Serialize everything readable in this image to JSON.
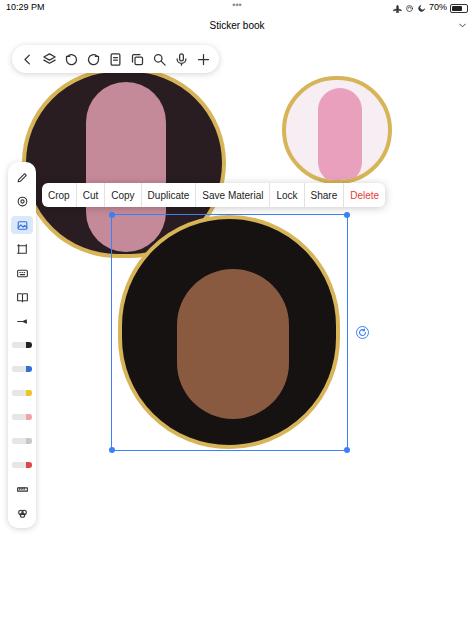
{
  "status_bar": {
    "time": "10:29 PM",
    "dots": "•••",
    "battery": "70%"
  },
  "document": {
    "title": "Sticker book"
  },
  "context_menu": {
    "items": [
      {
        "label": "Crop",
        "kind": "normal"
      },
      {
        "label": "Cut",
        "kind": "normal"
      },
      {
        "label": "Copy",
        "kind": "normal"
      },
      {
        "label": "Duplicate",
        "kind": "normal"
      },
      {
        "label": "Save Material",
        "kind": "normal"
      },
      {
        "label": "Lock",
        "kind": "normal"
      },
      {
        "label": "Share",
        "kind": "normal"
      },
      {
        "label": "Delete",
        "kind": "destructive"
      }
    ]
  },
  "tools": [
    {
      "kind": "pencil",
      "selected": false
    },
    {
      "kind": "camera",
      "selected": false
    },
    {
      "kind": "image",
      "selected": true
    },
    {
      "kind": "frame",
      "selected": false
    },
    {
      "kind": "keyboard",
      "selected": false
    },
    {
      "kind": "book",
      "selected": false
    },
    {
      "kind": "fountain",
      "selected": false
    },
    {
      "kind": "marker",
      "selected": false,
      "color": "#222222"
    },
    {
      "kind": "marker",
      "selected": false,
      "color": "#2f6fd6"
    },
    {
      "kind": "marker",
      "selected": false,
      "color": "#f0c419"
    },
    {
      "kind": "marker",
      "selected": false,
      "color": "#f4a0a8"
    },
    {
      "kind": "marker",
      "selected": false,
      "color": "#c8c8c8"
    },
    {
      "kind": "marker",
      "selected": false,
      "color": "#e04646"
    },
    {
      "kind": "ruler",
      "selected": false
    },
    {
      "kind": "palette",
      "selected": false
    }
  ],
  "stickers": [
    {
      "selected": false
    },
    {
      "selected": false
    },
    {
      "selected": true
    }
  ]
}
